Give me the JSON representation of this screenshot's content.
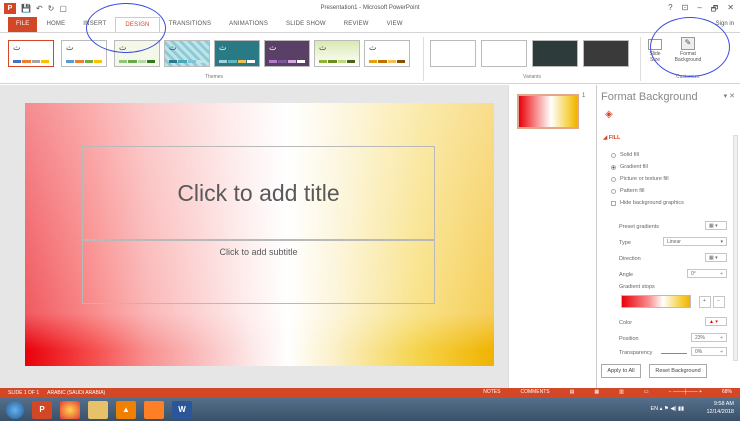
{
  "window": {
    "title": "Presentation1 - Microsoft PowerPoint",
    "controls": [
      "?",
      "⊡",
      "–",
      "🗗",
      "✕"
    ],
    "sign_in": "Sign in"
  },
  "qat": {
    "logo": "P"
  },
  "tabs": [
    "FILE",
    "HOME",
    "INSERT",
    "DESIGN",
    "TRANSITIONS",
    "ANIMATIONS",
    "SLIDE SHOW",
    "REVIEW",
    "VIEW"
  ],
  "active_tab": "DESIGN",
  "ribbon": {
    "themes_group": "Themes",
    "theme_glyph": "ث",
    "variants_group": "Variants",
    "customize_group": "Customize",
    "slide_size": "Slide Size",
    "format_background": "Format Background"
  },
  "slide": {
    "title_placeholder": "Click to add title",
    "subtitle_placeholder": "Click to add subtitle"
  },
  "thumbnail": {
    "number": "1"
  },
  "format_pane": {
    "title": "Format Background",
    "section": "FILL",
    "options": [
      "Solid fill",
      "Gradient fill",
      "Picture or texture fill",
      "Pattern fill"
    ],
    "selected_option": "Gradient fill",
    "hide_graphics": "Hide background graphics",
    "preset_gradients": "Preset gradients",
    "type_label": "Type",
    "type_value": "Linear",
    "direction_label": "Direction",
    "angle_label": "Angle",
    "angle_value": "0°",
    "gradient_stops": "Gradient stops",
    "color_label": "Color",
    "position_label": "Position",
    "position_value": "23%",
    "transparency_label": "Transparency",
    "transparency_value": "0%",
    "apply_all": "Apply to All",
    "reset": "Reset Background"
  },
  "statusbar": {
    "slide_info": "SLIDE 1 OF 1",
    "language": "ARABIC (SAUDI ARABIA)",
    "notes": "NOTES",
    "comments": "COMMENTS",
    "zoom": "68%"
  },
  "taskbar": {
    "language": "EN",
    "time": "9:58 AM",
    "date": "12/14/2018"
  },
  "colors": {
    "accent": "#d24726",
    "annotation": "#3b4de0"
  }
}
